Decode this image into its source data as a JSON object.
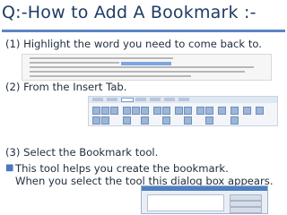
{
  "slide": {
    "title": "Q:-How to Add A Bookmark :-",
    "steps": [
      "(1) Highlight the word you need to come back to.",
      "(2) From the Insert Tab.",
      "(3) Select the Bookmark tool."
    ],
    "bullet": {
      "glyph": "■",
      "lines": [
        "This tool helps you create the bookmark.",
        "When you select the tool this dialog box appears."
      ]
    }
  },
  "colors": {
    "title": "#1f3b63",
    "rule": "#5b86c5",
    "bullet": "#4a79b8"
  }
}
